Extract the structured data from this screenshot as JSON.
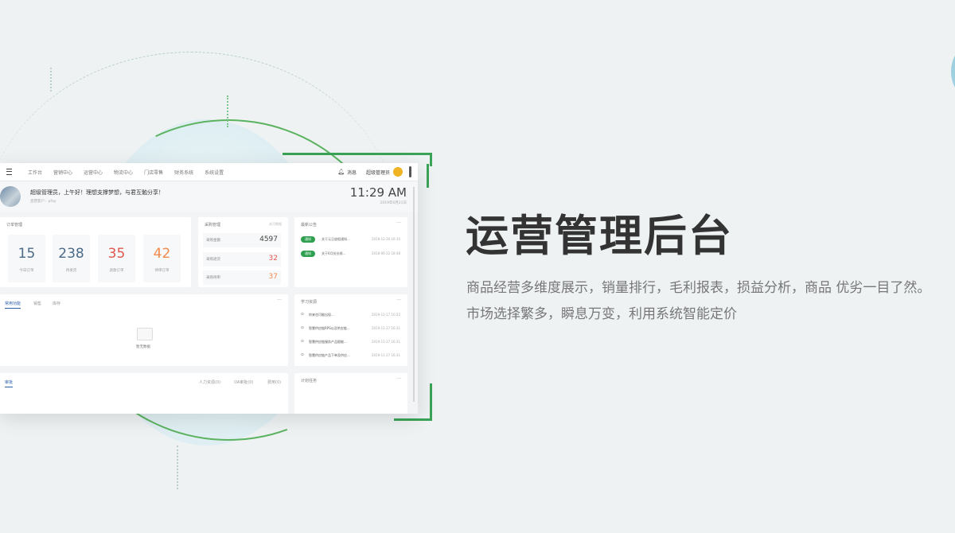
{
  "hero": {
    "title": "运营管理后台",
    "desc_line1": "商品经营多维度展示，销量排行，毛利报表，损益分析，商品 优劣一目了然。",
    "desc_line2": "市场选择繁多，瞬息万变，利用系统智能定价"
  },
  "dashboard": {
    "nav": [
      "工作台",
      "营销中心",
      "运营中心",
      "物流中心",
      "门店零售",
      "财务系统",
      "系统设置"
    ],
    "bell_icon": "bell-icon",
    "messages_label": "消息",
    "user_label": "超级管理员",
    "greeting": "超级管理员，上午好！理想支撑梦想，与君互勉分享！",
    "greeting_sub": "直营客户：pfay",
    "clock": "11:29 AM",
    "date": "2019年6月21日",
    "orders": {
      "title": "订单管理",
      "stats": [
        {
          "value": "15",
          "label": "今日订单",
          "color": "#4a6a87"
        },
        {
          "value": "238",
          "label": "待发货",
          "color": "#4a6a87"
        },
        {
          "value": "35",
          "label": "退款订单",
          "color": "#e0574f"
        },
        {
          "value": "42",
          "label": "待审订单",
          "color": "#ef8a4c"
        }
      ]
    },
    "purchase": {
      "title": "采购管理",
      "hint": "本月数据",
      "rows": [
        {
          "label": "采购金额",
          "value": "4597",
          "color": "#444"
        },
        {
          "label": "采购退货",
          "value": "32",
          "color": "#e0574f"
        },
        {
          "label": "采购待审",
          "value": "37",
          "color": "#ef8a4c"
        }
      ]
    },
    "notices": {
      "title": "最新公告",
      "rows": [
        {
          "tag": "通知",
          "text": "关于元旦放假通知...",
          "date": "2018-12-20 16:10"
        },
        {
          "tag": "通知",
          "text": "关于6月份业绩...",
          "date": "2018-06-22 18:48"
        }
      ]
    },
    "tabs": {
      "items": [
        "常用功能",
        "销售",
        "库存"
      ],
      "empty_text": "暂无数据"
    },
    "study": {
      "title": "学习资源",
      "rows": [
        {
          "text": "你来也可能出现...",
          "date": "2019-12-17 10:22"
        },
        {
          "text": "智慧供应链RPS以及供应链...",
          "date": "2019-11-27 16:31"
        },
        {
          "text": "智慧供应链服务产品赋能...",
          "date": "2019-11-27 16:31"
        },
        {
          "text": "智慧供应链产品下单及供应...",
          "date": "2019-11-27 16:31"
        }
      ]
    },
    "bottom_tabs": {
      "items": [
        "审批",
        "人力资源(0)",
        "OA审批(0)",
        "费用(0)"
      ]
    },
    "plan": {
      "title": "计划任务"
    }
  },
  "colors": {
    "accent_green": "#3aa356",
    "title_text": "#333333",
    "desc_text": "#777777"
  }
}
